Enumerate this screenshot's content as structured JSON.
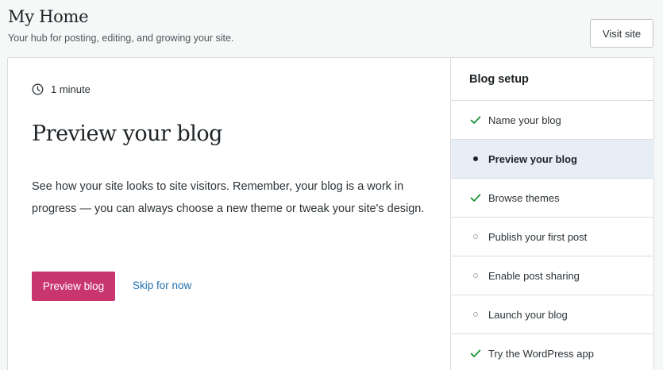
{
  "header": {
    "title": "My Home",
    "subtitle": "Your hub for posting, editing, and growing your site.",
    "visit_site_label": "Visit site"
  },
  "task": {
    "duration": "1 minute",
    "title": "Preview your blog",
    "description": "See how your site looks to site visitors. Remember, your blog is a work in progress — you can always choose a new theme or tweak your site's design.",
    "primary_label": "Preview blog",
    "skip_label": "Skip for now"
  },
  "checklist": {
    "title": "Blog setup",
    "steps": [
      {
        "label": "Name your blog",
        "state": "done"
      },
      {
        "label": "Preview your blog",
        "state": "active"
      },
      {
        "label": "Browse themes",
        "state": "done"
      },
      {
        "label": "Publish your first post",
        "state": "todo"
      },
      {
        "label": "Enable post sharing",
        "state": "todo"
      },
      {
        "label": "Launch your blog",
        "state": "todo"
      },
      {
        "label": "Try the WordPress app",
        "state": "done"
      }
    ]
  },
  "colors": {
    "accent": "#c9356e",
    "link": "#2271b1",
    "check": "#008a20",
    "active_row": "#e8eef5"
  }
}
